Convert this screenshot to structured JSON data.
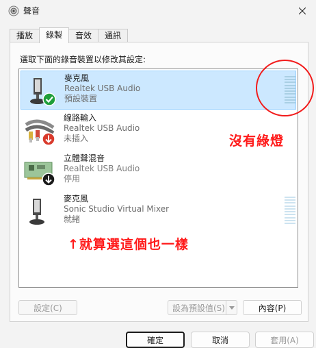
{
  "window": {
    "title": "聲音",
    "close_icon": "close-icon"
  },
  "tabs": [
    {
      "label": "播放",
      "active": false
    },
    {
      "label": "錄製",
      "active": true
    },
    {
      "label": "音效",
      "active": false
    },
    {
      "label": "通訊",
      "active": false
    }
  ],
  "instruction": "選取下面的錄音裝置以修改其設定:",
  "devices": [
    {
      "name": "麥克風",
      "driver": "Realtek USB Audio",
      "status": "預設裝置",
      "icon": "microphone-icon",
      "badge": "default-check-icon",
      "selected": true,
      "level": 0
    },
    {
      "name": "線路輸入",
      "driver": "Realtek USB Audio",
      "status": "未插入",
      "icon": "line-in-cable-icon",
      "badge": "unplugged-arrow-icon",
      "selected": false,
      "level": null
    },
    {
      "name": "立體聲混音",
      "driver": "Realtek USB Audio",
      "status": "停用",
      "icon": "sound-card-icon",
      "badge": "disabled-arrow-icon",
      "selected": false,
      "level": null
    },
    {
      "name": "麥克風",
      "driver": "Sonic Studio Virtual Mixer",
      "status": "就緒",
      "icon": "microphone-icon",
      "badge": null,
      "selected": false,
      "level": 0
    }
  ],
  "buttons": {
    "configure": "設定(C)",
    "set_default": "設為預設值(S)",
    "properties": "內容(P)",
    "ok": "確定",
    "cancel": "取消",
    "apply": "套用(A)"
  },
  "annotations": {
    "no_green_light": "沒有綠燈",
    "even_this_one": "↑就算選這個也一樣"
  },
  "colors": {
    "selection": "#cce8ff",
    "annotation": "#ff1a1a",
    "meter": "#a9cfe4"
  }
}
